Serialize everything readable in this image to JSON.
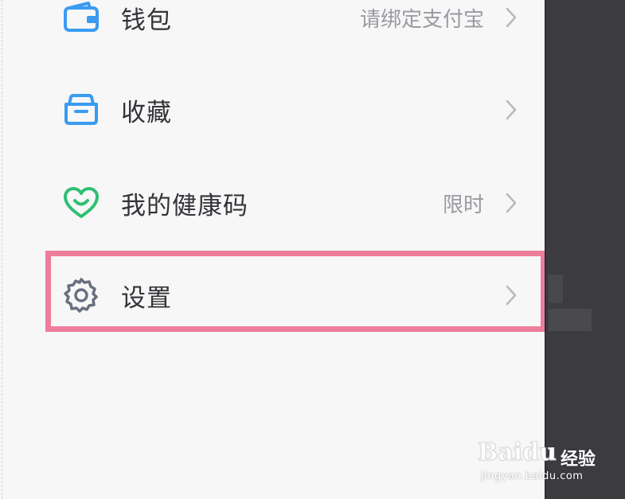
{
  "menu": {
    "items": [
      {
        "label": "钱包",
        "right_text": "请绑定支付宝",
        "icon": "wallet-icon",
        "icon_color": "#3a9bf0"
      },
      {
        "label": "收藏",
        "right_text": "",
        "icon": "folder-icon",
        "icon_color": "#3a9bf0"
      },
      {
        "label": "我的健康码",
        "right_text": "限时",
        "icon": "heart-icon",
        "icon_color": "#2fbf71"
      },
      {
        "label": "设置",
        "right_text": "",
        "icon": "gear-icon",
        "icon_color": "#6a6f80"
      }
    ]
  },
  "highlight": {
    "target": "设置",
    "color": "#ee7c9b"
  },
  "watermark": {
    "brand": "Baidu",
    "brand_cn": "经验",
    "url": "jingyan.baidu.com"
  }
}
